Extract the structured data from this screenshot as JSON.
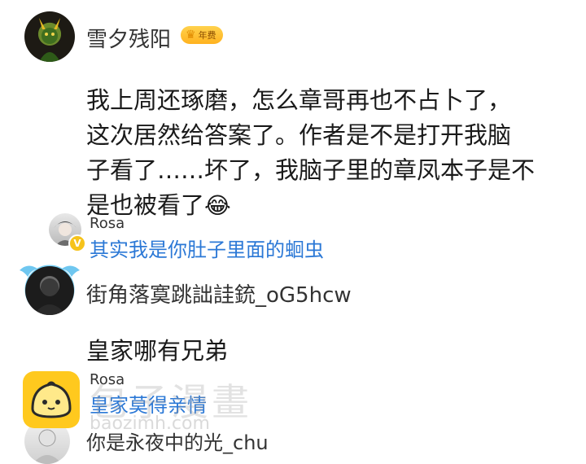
{
  "comment1": {
    "username": "雪夕残阳",
    "badge_label": "年费",
    "text_lines": [
      "我上周还琢磨，怎么章哥再也不占卜了，",
      "这次居然给答案了。作者是不是打开我脑",
      "子看了……坏了，我脑子里的章凤本子是不",
      "是也被看了"
    ],
    "emoji": "😂",
    "reply": {
      "name": "Rosa",
      "verified_mark": "V",
      "text": "其实我是你肚子里面的蛔虫"
    }
  },
  "comment2": {
    "username": "街角落寞跳詘詿銃_oG5hcw",
    "text": "皇家哪有兄弟",
    "reply": {
      "name": "Rosa",
      "text": "皇家莫得亲情"
    }
  },
  "comment3": {
    "username": "你是永夜中的光_chu"
  },
  "watermark": {
    "text": "包子漫畫",
    "url": "baozimh.com"
  },
  "colors": {
    "reply_link": "#2b78d6",
    "vip_gold": "#ffc52a",
    "app_icon_yellow": "#ffc91e"
  }
}
